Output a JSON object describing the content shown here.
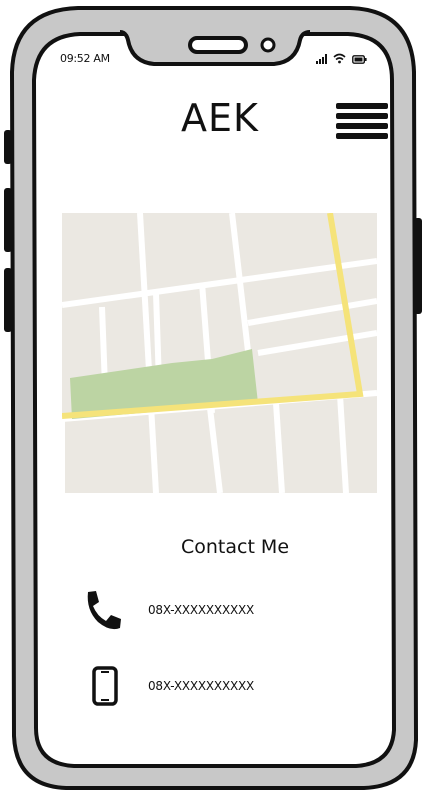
{
  "status_bar": {
    "time": "09:52 AM",
    "icons": [
      "signal-icon",
      "wifi-icon",
      "battery-icon"
    ]
  },
  "header": {
    "title": "AEK",
    "menu_icon": "hamburger-menu-icon"
  },
  "map": {
    "colors": {
      "land": "#ebe8e2",
      "road": "#ffffff",
      "highway": "#f5e37a",
      "park": "#bcd4a3"
    }
  },
  "contact": {
    "title": "Contact Me",
    "items": [
      {
        "icon": "telephone-icon",
        "value": "08X-XXXXXXXXXX"
      },
      {
        "icon": "mobile-phone-icon",
        "value": "08X-XXXXXXXXXX"
      }
    ]
  }
}
